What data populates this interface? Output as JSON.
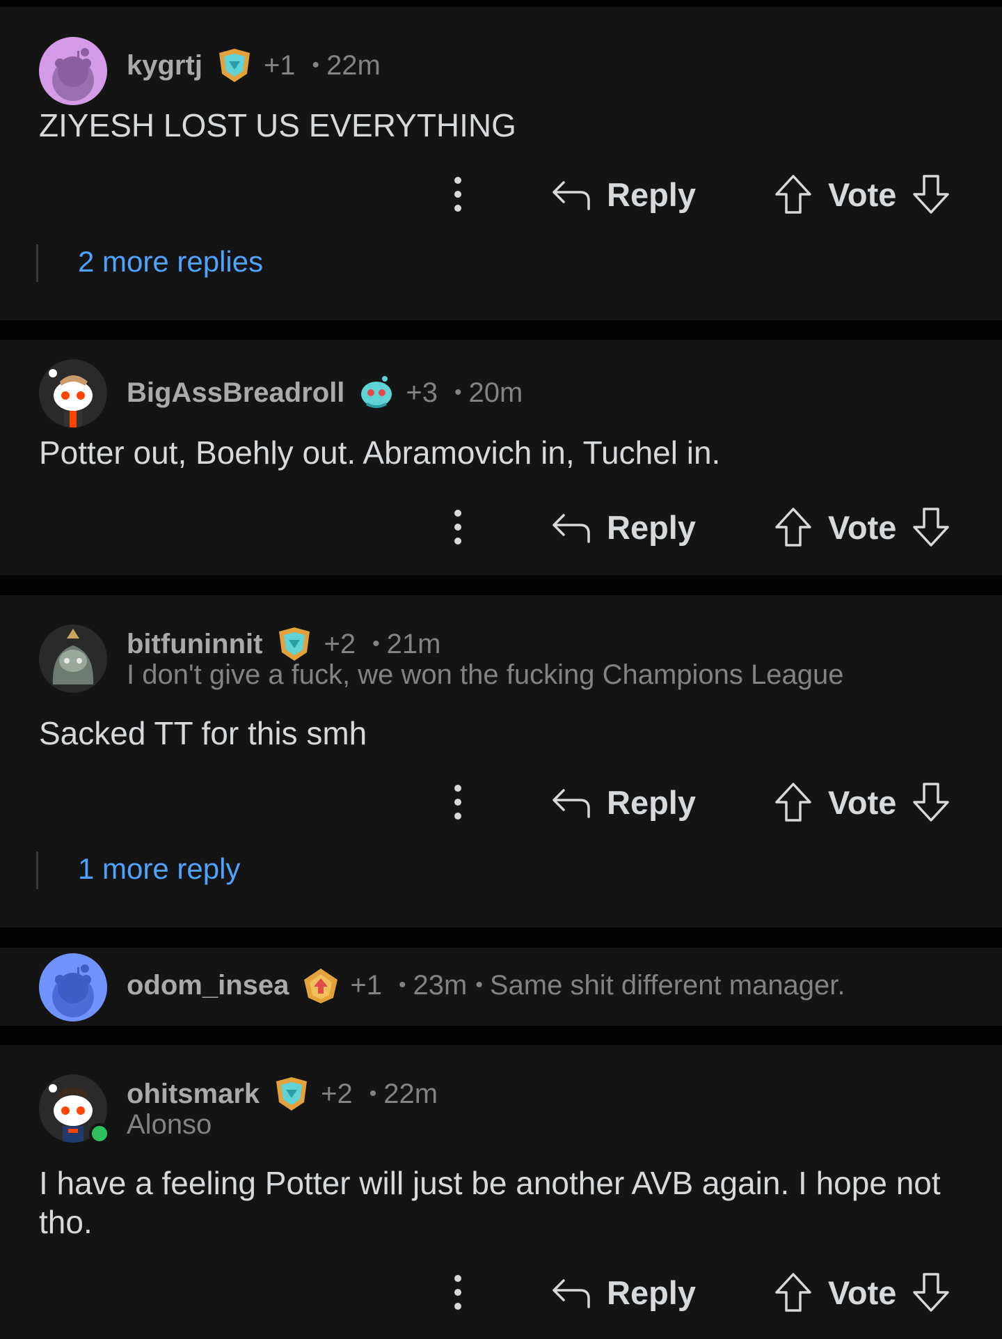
{
  "comments": [
    {
      "username": "kygrtj",
      "score": "+1",
      "time": "22m",
      "body": "ZIYESH LOST US EVERYTHING",
      "more_replies": "2 more replies"
    },
    {
      "username": "BigAssBreadroll",
      "score": "+3",
      "time": "20m",
      "body": "Potter out, Boehly out. Abramovich in, Tuchel in."
    },
    {
      "username": "bitfuninnit",
      "score": "+2",
      "time": "21m",
      "flair": "I don't give a fuck, we won the fucking Champions League",
      "body": "Sacked TT for this smh",
      "more_replies": "1 more reply"
    },
    {
      "username": "odom_insea",
      "score": "+1",
      "time": "23m",
      "collapsed_text": "Same shit different manager."
    },
    {
      "username": "ohitsmark",
      "score": "+2",
      "time": "22m",
      "flair": "Alonso",
      "body": "I have a feeling Potter will just be another AVB again. I hope not tho."
    }
  ],
  "actions": {
    "reply": "Reply",
    "vote": "Vote"
  },
  "colors": {
    "background": "#030303",
    "card": "#141414",
    "link": "#4fa3ff",
    "online": "#2ec25e"
  },
  "icons": [
    "snoo-avatar-icon",
    "award-icon",
    "more-options-icon",
    "reply-arrow-icon",
    "upvote-arrow-icon",
    "downvote-arrow-icon"
  ]
}
